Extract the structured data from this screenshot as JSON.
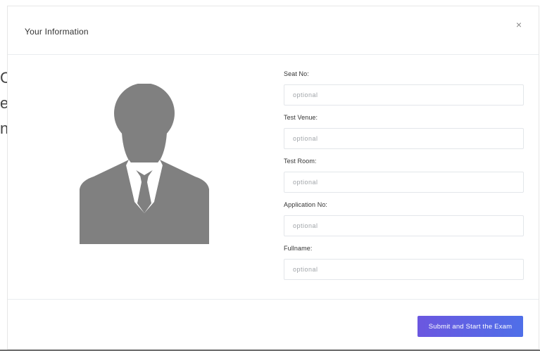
{
  "background_fragments": [
    "C",
    "e",
    "n"
  ],
  "modal": {
    "title": "Your Information",
    "close_label": "×"
  },
  "avatar": {
    "icon": "user-silhouette-icon",
    "color": "#808080"
  },
  "form": {
    "fields": [
      {
        "label": "Seat No:",
        "placeholder": "optional",
        "value": ""
      },
      {
        "label": "Test Venue:",
        "placeholder": "optional",
        "value": ""
      },
      {
        "label": "Test Room:",
        "placeholder": "optional",
        "value": ""
      },
      {
        "label": "Application No:",
        "placeholder": "optional",
        "value": ""
      },
      {
        "label": "Fullname:",
        "placeholder": "optional",
        "value": ""
      }
    ]
  },
  "footer": {
    "submit_label": "Submit and Start the Exam",
    "submit_color_start": "#6b57e0",
    "submit_color_end": "#4f6fe8"
  }
}
